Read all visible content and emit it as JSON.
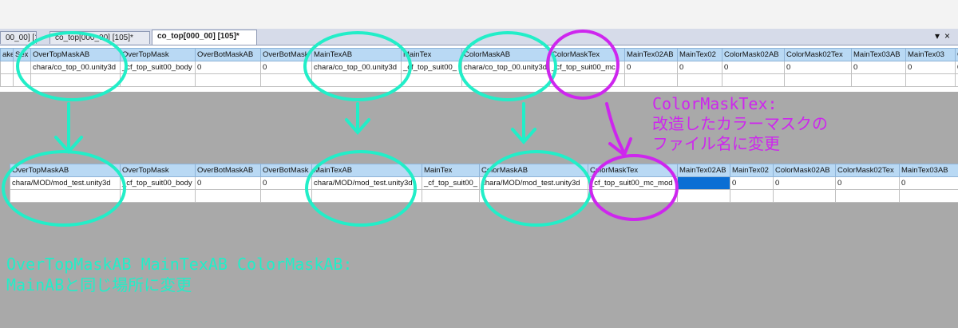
{
  "tabs": [
    "00_00] [105]",
    "co_top[000_00] [105]*",
    "co_top[000_00] [105]*"
  ],
  "tab_close_icon": "×",
  "tab_close_symbol": "▾",
  "grid_top": {
    "headers": [
      "ake",
      "Sex",
      "OverTopMaskAB",
      "OverTopMask",
      "OverBotMaskAB",
      "OverBotMask",
      "MainTexAB",
      "MainTex",
      "ColorMaskAB",
      "ColorMaskTex",
      "MainTex02AB",
      "MainTex02",
      "ColorMask02AB",
      "ColorMask02Tex",
      "MainTex03AB",
      "MainTex03",
      "Co"
    ],
    "row": [
      "",
      "",
      "chara/co_top_00.unity3d",
      "_cf_top_suit00_body",
      "0",
      "0",
      "chara/co_top_00.unity3d",
      "_cf_top_suit00_",
      "chara/co_top_00.unity3d",
      "_cf_top_suit00_mc",
      "0",
      "0",
      "0",
      "0",
      "0",
      "0",
      "0"
    ]
  },
  "grid_bottom": {
    "headers": [
      "OverTopMaskAB",
      "OverTopMask",
      "OverBotMaskAB",
      "OverBotMask",
      "MainTexAB",
      "MainTex",
      "ColorMaskAB",
      "ColorMaskTex",
      "MainTex02AB",
      "MainTex02",
      "ColorMask02AB",
      "ColorMask02Tex",
      "MainTex03AB"
    ],
    "row": [
      "chara/MOD/mod_test.unity3d",
      "_cf_top_suit00_body",
      "0",
      "0",
      "chara/MOD/mod_test.unity3d",
      "_cf_top_suit00_",
      "chara/MOD/mod_test.unity3d",
      "_cf_top_suit00_mc_mod",
      "",
      "0",
      "0",
      "0",
      "0"
    ]
  },
  "annotation_pink": [
    "ColorMaskTex:",
    "改造したカラーマスクの",
    "ファイル名に変更"
  ],
  "annotation_green": [
    "OverTopMaskAB MainTexAB ColorMaskAB:",
    "MainABと同じ場所に変更"
  ],
  "colors": {
    "annotation_green": "#22eec8",
    "annotation_pink": "#ce26ee",
    "header_bg": "#b9d9f4",
    "selected_cell": "#0b6ed4"
  }
}
